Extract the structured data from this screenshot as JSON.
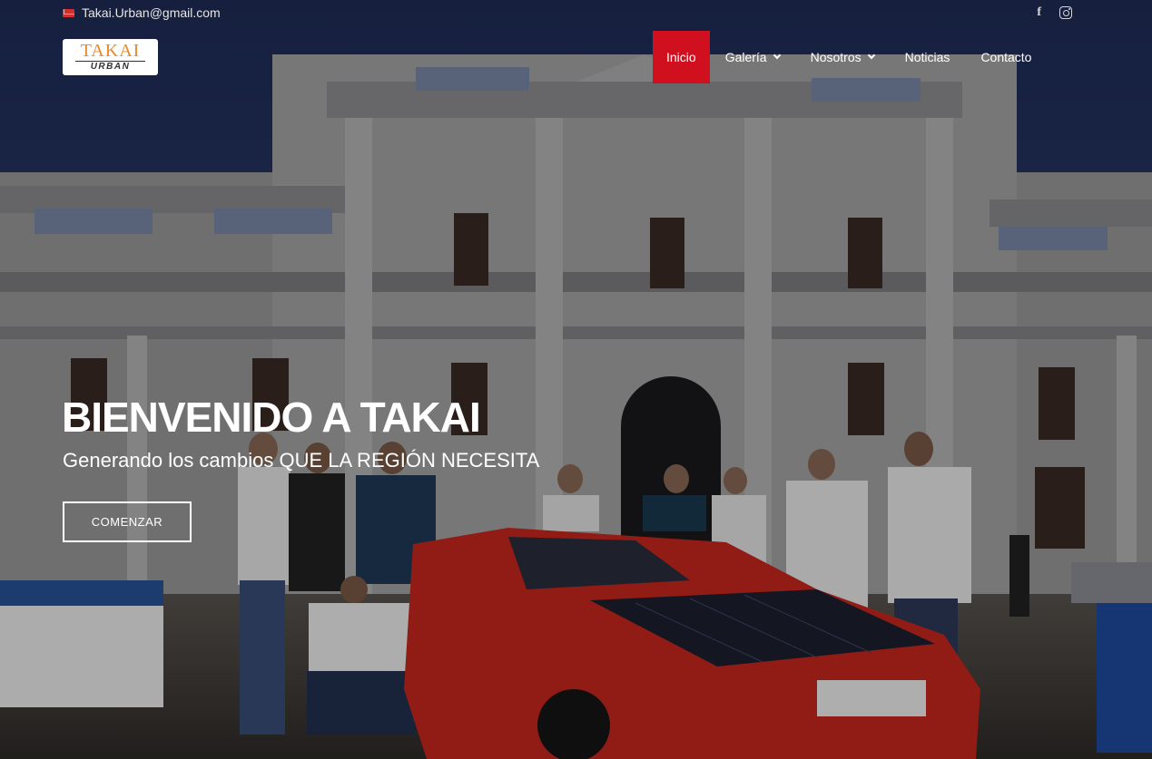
{
  "topbar": {
    "email": "Takai.Urban@gmail.com",
    "email_icon": "envelope-icon",
    "social": [
      {
        "name": "facebook",
        "icon": "f"
      },
      {
        "name": "instagram",
        "icon": "instagram-icon"
      }
    ]
  },
  "logo": {
    "top": "TAKAI",
    "bottom": "URBAN"
  },
  "nav": {
    "items": [
      {
        "label": "Inicio",
        "active": true,
        "dropdown": false
      },
      {
        "label": "Galería",
        "active": false,
        "dropdown": true
      },
      {
        "label": "Nosotros",
        "active": false,
        "dropdown": true
      },
      {
        "label": "Noticias",
        "active": false,
        "dropdown": false
      },
      {
        "label": "Contacto",
        "active": false,
        "dropdown": false
      }
    ]
  },
  "hero": {
    "title": "BIENVENIDO A TAKAI",
    "subtitle": "Generando los cambios QUE LA REGIÓN NECESITA",
    "cta": "COMENZAR"
  },
  "colors": {
    "accent": "#d0101f",
    "logo_orange": "#e8892b",
    "sky": "#2a3a6b",
    "car": "#c8281e"
  }
}
